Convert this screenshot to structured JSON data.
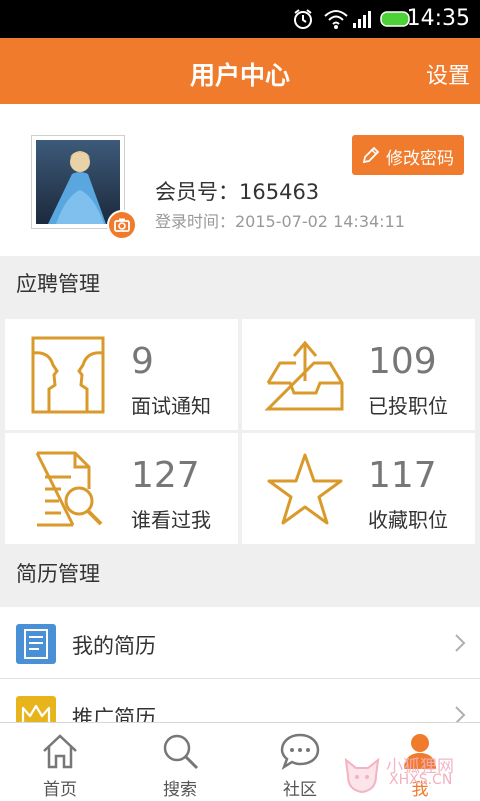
{
  "status": {
    "time": "14:35"
  },
  "appbar": {
    "title": "用户中心",
    "settings_label": "设置"
  },
  "profile": {
    "change_password_label": "修改密码",
    "member_label": "会员号：165463",
    "login_time_label": "登录时间：2015-07-02 14:34:11"
  },
  "recruit": {
    "section_title": "应聘管理",
    "cards": [
      {
        "count": "9",
        "label": "面试通知",
        "icon": "profiles-icon"
      },
      {
        "count": "109",
        "label": "已投职位",
        "icon": "upload-tray-icon"
      },
      {
        "count": "127",
        "label": "谁看过我",
        "icon": "document-search-icon"
      },
      {
        "count": "117",
        "label": "收藏职位",
        "icon": "star-icon"
      }
    ]
  },
  "resume": {
    "section_title": "简历管理",
    "items": [
      {
        "label": "我的简历",
        "icon": "document-icon"
      },
      {
        "label": "推广简历",
        "icon": "crown-icon"
      }
    ]
  },
  "tabs": [
    {
      "label": "首页",
      "icon": "home-icon"
    },
    {
      "label": "搜索",
      "icon": "search-icon"
    },
    {
      "label": "社区",
      "icon": "chat-icon"
    },
    {
      "label": "我",
      "icon": "person-icon"
    }
  ],
  "watermark": {
    "line1": "小狐狸网",
    "line2": "XHXS.CN"
  },
  "colors": {
    "accent": "#f07b2c",
    "icon_gold": "#d99a2b",
    "doc_blue": "#4a90d6"
  }
}
